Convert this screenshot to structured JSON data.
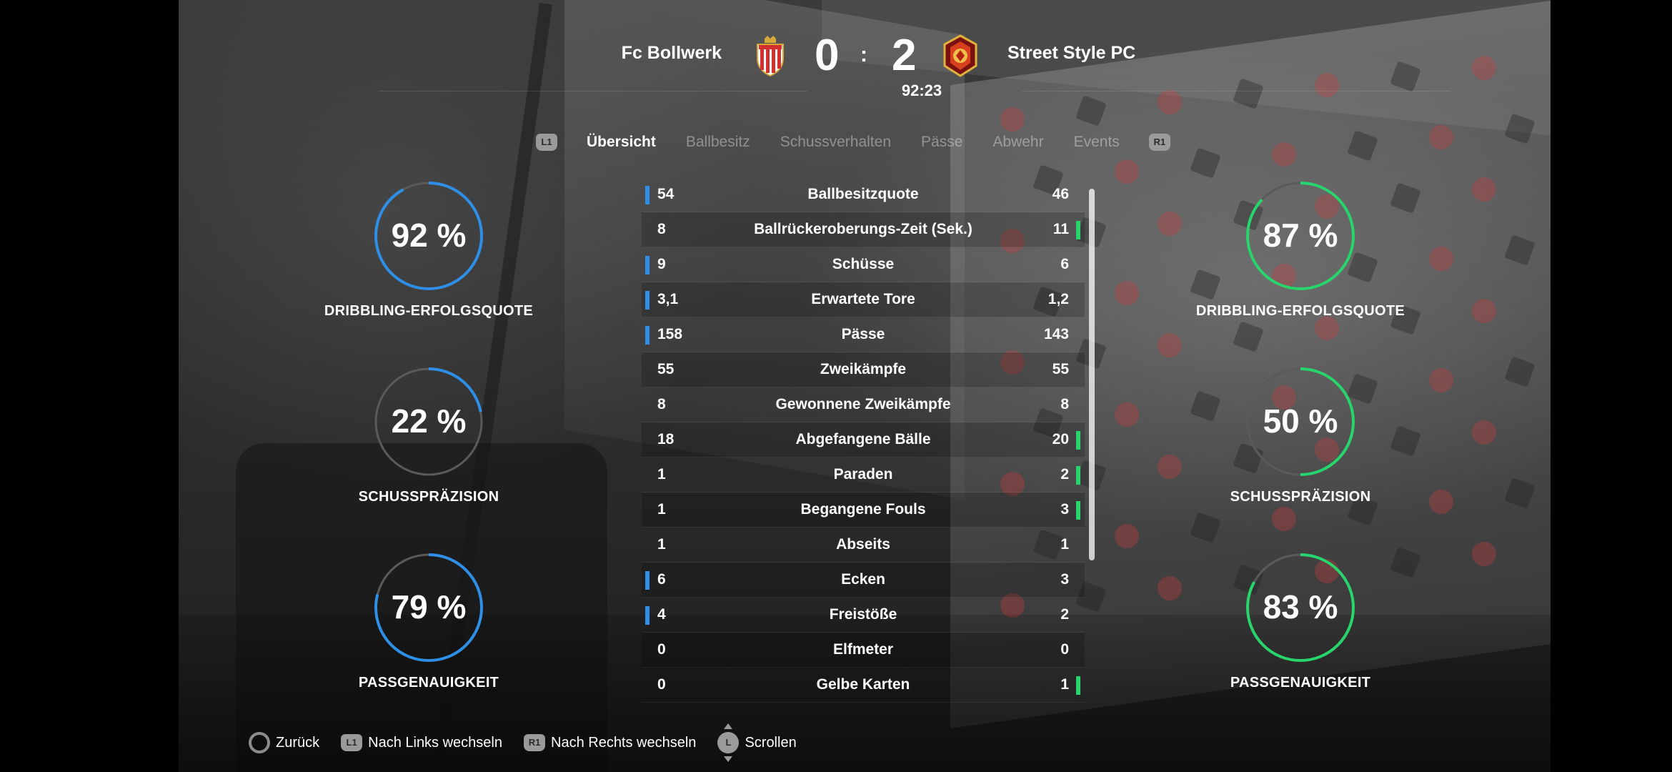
{
  "scoreboard": {
    "home_team": "Fc Bollwerk",
    "away_team": "Street Style PC",
    "home_score": "0",
    "separator": ":",
    "away_score": "2",
    "match_time": "92:23"
  },
  "tabs": {
    "left_button": "L1",
    "right_button": "R1",
    "items": [
      "Übersicht",
      "Ballbesitz",
      "Schussverhalten",
      "Pässe",
      "Abwehr",
      "Events"
    ],
    "active_index": 0
  },
  "colors": {
    "home_accent": "#2f8fe6",
    "away_accent": "#28d46c",
    "gauge_track": "#5a5a5a"
  },
  "home_gauges": [
    {
      "value_text": "92 %",
      "percent": 92,
      "label": "DRIBBLING-ERFOLGSQUOTE"
    },
    {
      "value_text": "22 %",
      "percent": 22,
      "label": "SCHUSSPRÄZISION"
    },
    {
      "value_text": "79 %",
      "percent": 79,
      "label": "PASSGENAUIGKEIT"
    }
  ],
  "away_gauges": [
    {
      "value_text": "87 %",
      "percent": 87,
      "label": "DRIBBLING-ERFOLGSQUOTE"
    },
    {
      "value_text": "50 %",
      "percent": 50,
      "label": "SCHUSSPRÄZISION"
    },
    {
      "value_text": "83 %",
      "percent": 83,
      "label": "PASSGENAUIGKEIT"
    }
  ],
  "stats": [
    {
      "home": "54",
      "name": "Ballbesitzquote",
      "away": "46",
      "leader": "home"
    },
    {
      "home": "8",
      "name": "Ballrückeroberungs-Zeit (Sek.)",
      "away": "11",
      "leader": "away"
    },
    {
      "home": "9",
      "name": "Schüsse",
      "away": "6",
      "leader": "home"
    },
    {
      "home": "3,1",
      "name": "Erwartete Tore",
      "away": "1,2",
      "leader": "home"
    },
    {
      "home": "158",
      "name": "Pässe",
      "away": "143",
      "leader": "home"
    },
    {
      "home": "55",
      "name": "Zweikämpfe",
      "away": "55",
      "leader": "none"
    },
    {
      "home": "8",
      "name": "Gewonnene Zweikämpfe",
      "away": "8",
      "leader": "none"
    },
    {
      "home": "18",
      "name": "Abgefangene Bälle",
      "away": "20",
      "leader": "away"
    },
    {
      "home": "1",
      "name": "Paraden",
      "away": "2",
      "leader": "away"
    },
    {
      "home": "1",
      "name": "Begangene Fouls",
      "away": "3",
      "leader": "away"
    },
    {
      "home": "1",
      "name": "Abseits",
      "away": "1",
      "leader": "none"
    },
    {
      "home": "6",
      "name": "Ecken",
      "away": "3",
      "leader": "home"
    },
    {
      "home": "4",
      "name": "Freistöße",
      "away": "2",
      "leader": "home"
    },
    {
      "home": "0",
      "name": "Elfmeter",
      "away": "0",
      "leader": "none"
    },
    {
      "home": "0",
      "name": "Gelbe Karten",
      "away": "1",
      "leader": "away"
    }
  ],
  "footer": {
    "back_label": "Zurück",
    "l1_badge": "L1",
    "left_label": "Nach Links wechseln",
    "r1_badge": "R1",
    "right_label": "Nach Rechts wechseln",
    "stick_badge": "L",
    "scroll_label": "Scrollen"
  },
  "icons": {
    "home_crest": "red-white-shield-crest-icon",
    "away_crest": "red-gold-lion-crest-icon",
    "back_button": "circle-button-icon",
    "scroll_button": "left-stick-icon"
  }
}
